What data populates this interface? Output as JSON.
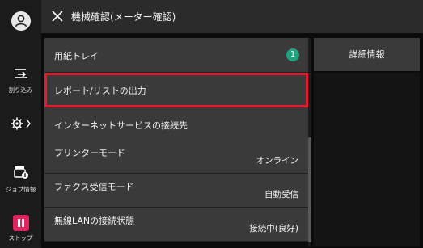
{
  "header": {
    "title": "機械確認(メーター確認)"
  },
  "rail": {
    "interrupt_label": "割り込み",
    "jobinfo_label": "ジョブ情報",
    "stop_label": "ストップ"
  },
  "menu": [
    {
      "label": "用紙トレイ",
      "badge": "1"
    },
    {
      "label": "レポート/リストの出力",
      "selected": true
    },
    {
      "label": "インターネットサービスの接続先"
    }
  ],
  "status": [
    {
      "label": "プリンターモード",
      "value": "オンライン"
    },
    {
      "label": "ファクス受信モード",
      "value": "自動受信"
    },
    {
      "label": "無線LANの接続状態",
      "value": "接続中(良好)"
    }
  ],
  "side": {
    "detail_label": "詳細情報"
  },
  "colors": {
    "selection": "#e21b31",
    "badge": "#1fa37f",
    "stop": "#e0245e"
  }
}
